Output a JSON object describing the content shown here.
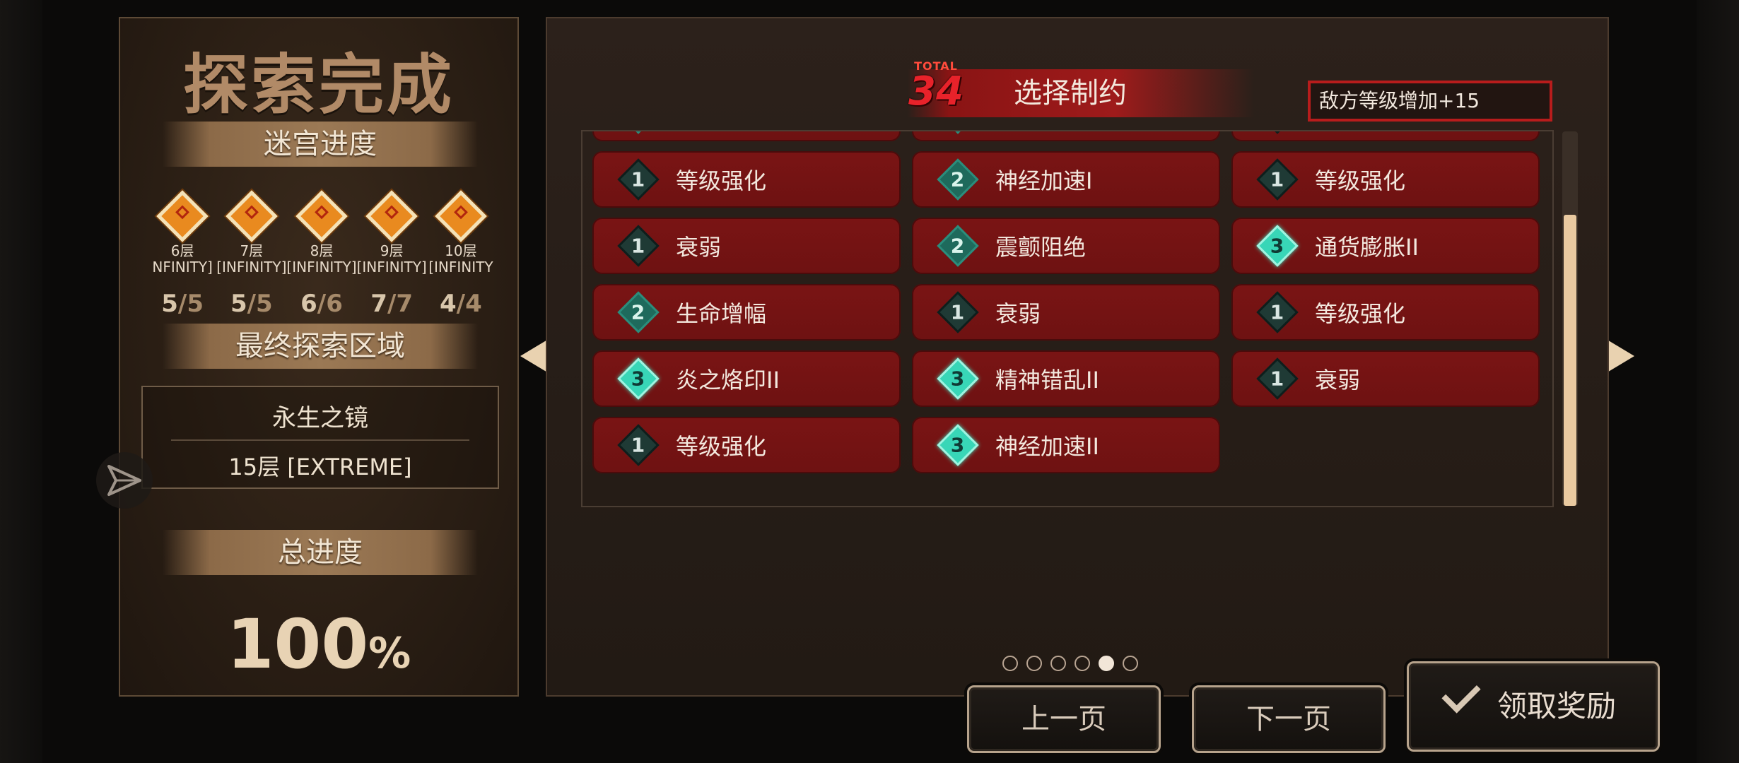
{
  "left": {
    "title": "探索完成",
    "maze_progress_label": "迷宫进度",
    "floors": [
      {
        "name": "6层",
        "mode": "NFINITY]",
        "done": "5",
        "total": "/5"
      },
      {
        "name": "7层",
        "mode": "[INFINITY]",
        "done": "5",
        "total": "/5"
      },
      {
        "name": "8层",
        "mode": "[INFINITY]",
        "done": "6",
        "total": "/6"
      },
      {
        "name": "9层",
        "mode": "[INFINITY]",
        "done": "7",
        "total": "/7"
      },
      {
        "name": "10层",
        "mode": "[INFINITY",
        "done": "4",
        "total": "/4"
      }
    ],
    "final_zone_label": "最终探索区域",
    "zone_name": "永生之镜",
    "zone_floor": "15层 [EXTREME]",
    "total_progress_label": "总进度",
    "total_progress_value": "100",
    "total_progress_unit": "%"
  },
  "right": {
    "total_label": "TOTAL",
    "total_count": "34",
    "title": "选择制约",
    "enemy_level_text": "敌方等级增加+15",
    "constraints": [
      {
        "rank": "1",
        "label": "等级强化"
      },
      {
        "rank": "2",
        "label": "神经加速I"
      },
      {
        "rank": "1",
        "label": "等级强化"
      },
      {
        "rank": "1",
        "label": "衰弱"
      },
      {
        "rank": "2",
        "label": "震颤阻绝"
      },
      {
        "rank": "3",
        "label": "通货膨胀II"
      },
      {
        "rank": "2",
        "label": "生命增幅"
      },
      {
        "rank": "1",
        "label": "衰弱"
      },
      {
        "rank": "1",
        "label": "等级强化"
      },
      {
        "rank": "3",
        "label": "炎之烙印II"
      },
      {
        "rank": "3",
        "label": "精神错乱II"
      },
      {
        "rank": "1",
        "label": "衰弱"
      },
      {
        "rank": "1",
        "label": "等级强化"
      },
      {
        "rank": "3",
        "label": "神经加速II"
      }
    ],
    "pages": 6,
    "current_page_index": 4
  },
  "buttons": {
    "prev": "上一页",
    "next": "下一页",
    "claim": "领取奖励"
  },
  "icons": {
    "share": "send-icon",
    "check": "check-icon",
    "prev_arrow": "triangle-left-icon",
    "next_arrow": "triangle-right-icon"
  },
  "colors": {
    "card_red": "#7a1414",
    "rank3_teal": "#38d6b7",
    "banner_tan": "#9b7955",
    "highlight_red": "#b81c1c"
  }
}
